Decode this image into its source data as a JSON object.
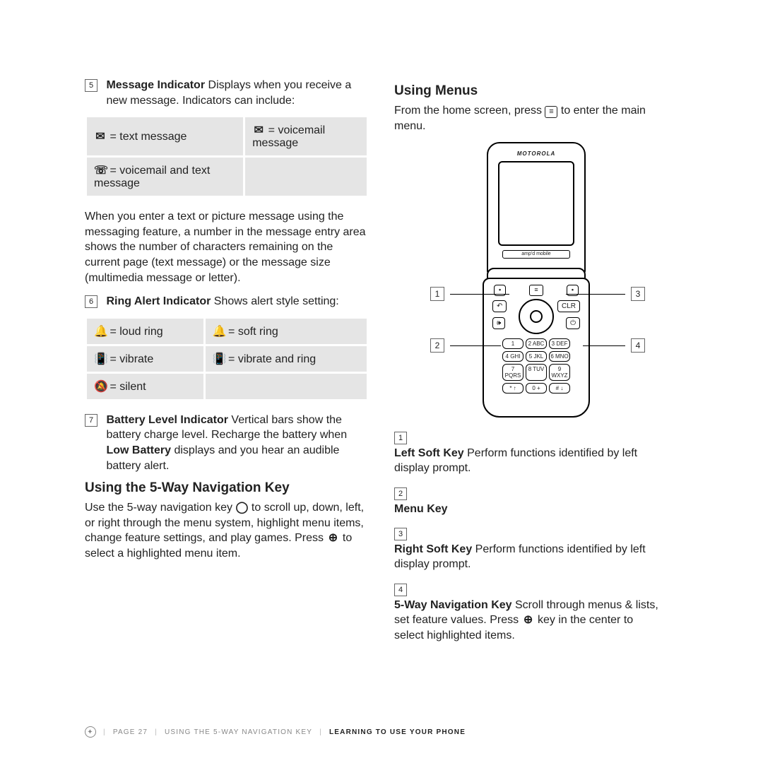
{
  "left": {
    "item5_num": "5",
    "item5_title": "Message Indicator",
    "item5_text": "Displays when you receive a new message. Indicators can include:",
    "msg_tbl": {
      "a": "= text message",
      "b": "= voicemail message",
      "c": "= voicemail and text message"
    },
    "msg_para": "When you enter a text or picture message using the messaging feature, a number in the message entry area shows the number of characters remaining on the current page (text message) or the message size (multimedia message or letter).",
    "item6_num": "6",
    "item6_title": "Ring Alert Indicator",
    "item6_text": "Shows alert style setting:",
    "ring_tbl": {
      "a": "= loud ring",
      "b": "= soft ring",
      "c": "= vibrate",
      "d": "= vibrate and ring",
      "e": "= silent"
    },
    "item7_num": "7",
    "item7_title": "Battery Level Indicator",
    "item7_text_a": "Vertical bars show the battery charge level. Recharge the battery when ",
    "item7_bold": "Low Battery",
    "item7_text_b": " displays and you hear an audible battery alert.",
    "nav_head": "Using the 5-Way Navigation Key",
    "nav_para_a": "Use the 5-way navigation key ",
    "nav_para_b": " to scroll up, down, left, or right through the menu system, highlight menu items, change feature settings, and play games. Press ",
    "nav_para_c": " to select a highlighted menu item."
  },
  "right": {
    "menus_head": "Using Menus",
    "menus_para_a": "From the home screen, press ",
    "menus_para_b": " to enter the main menu.",
    "brand": "MOTOROLA",
    "sublabel": "amp'd mobile",
    "callouts": {
      "c1": "1",
      "c2": "2",
      "c3": "3",
      "c4": "4"
    },
    "keys": [
      "1",
      "2 ABC",
      "3 DEF",
      "4 GHI",
      "5 JKL",
      "6 MNO",
      "7 PQRS",
      "8 TUV",
      "9 WXYZ",
      "* ↑",
      "0 +",
      "# ↓"
    ],
    "list": {
      "n1": "1",
      "t1": "Left Soft Key",
      "d1": " Perform functions identified by left display prompt.",
      "n2": "2",
      "t2": "Menu Key",
      "d2": "",
      "n3": "3",
      "t3": "Right Soft Key",
      "d3": " Perform functions identified by left display prompt.",
      "n4": "4",
      "t4": "5-Way Navigation Key",
      "d4a": " Scroll through menus & lists, set feature values. Press ",
      "d4b": " key in the center to select highlighted items."
    }
  },
  "footer": {
    "page": "PAGE 27",
    "mid": "USING THE 5-WAY NAVIGATION KEY",
    "right": "LEARNING TO USE YOUR PHONE"
  }
}
